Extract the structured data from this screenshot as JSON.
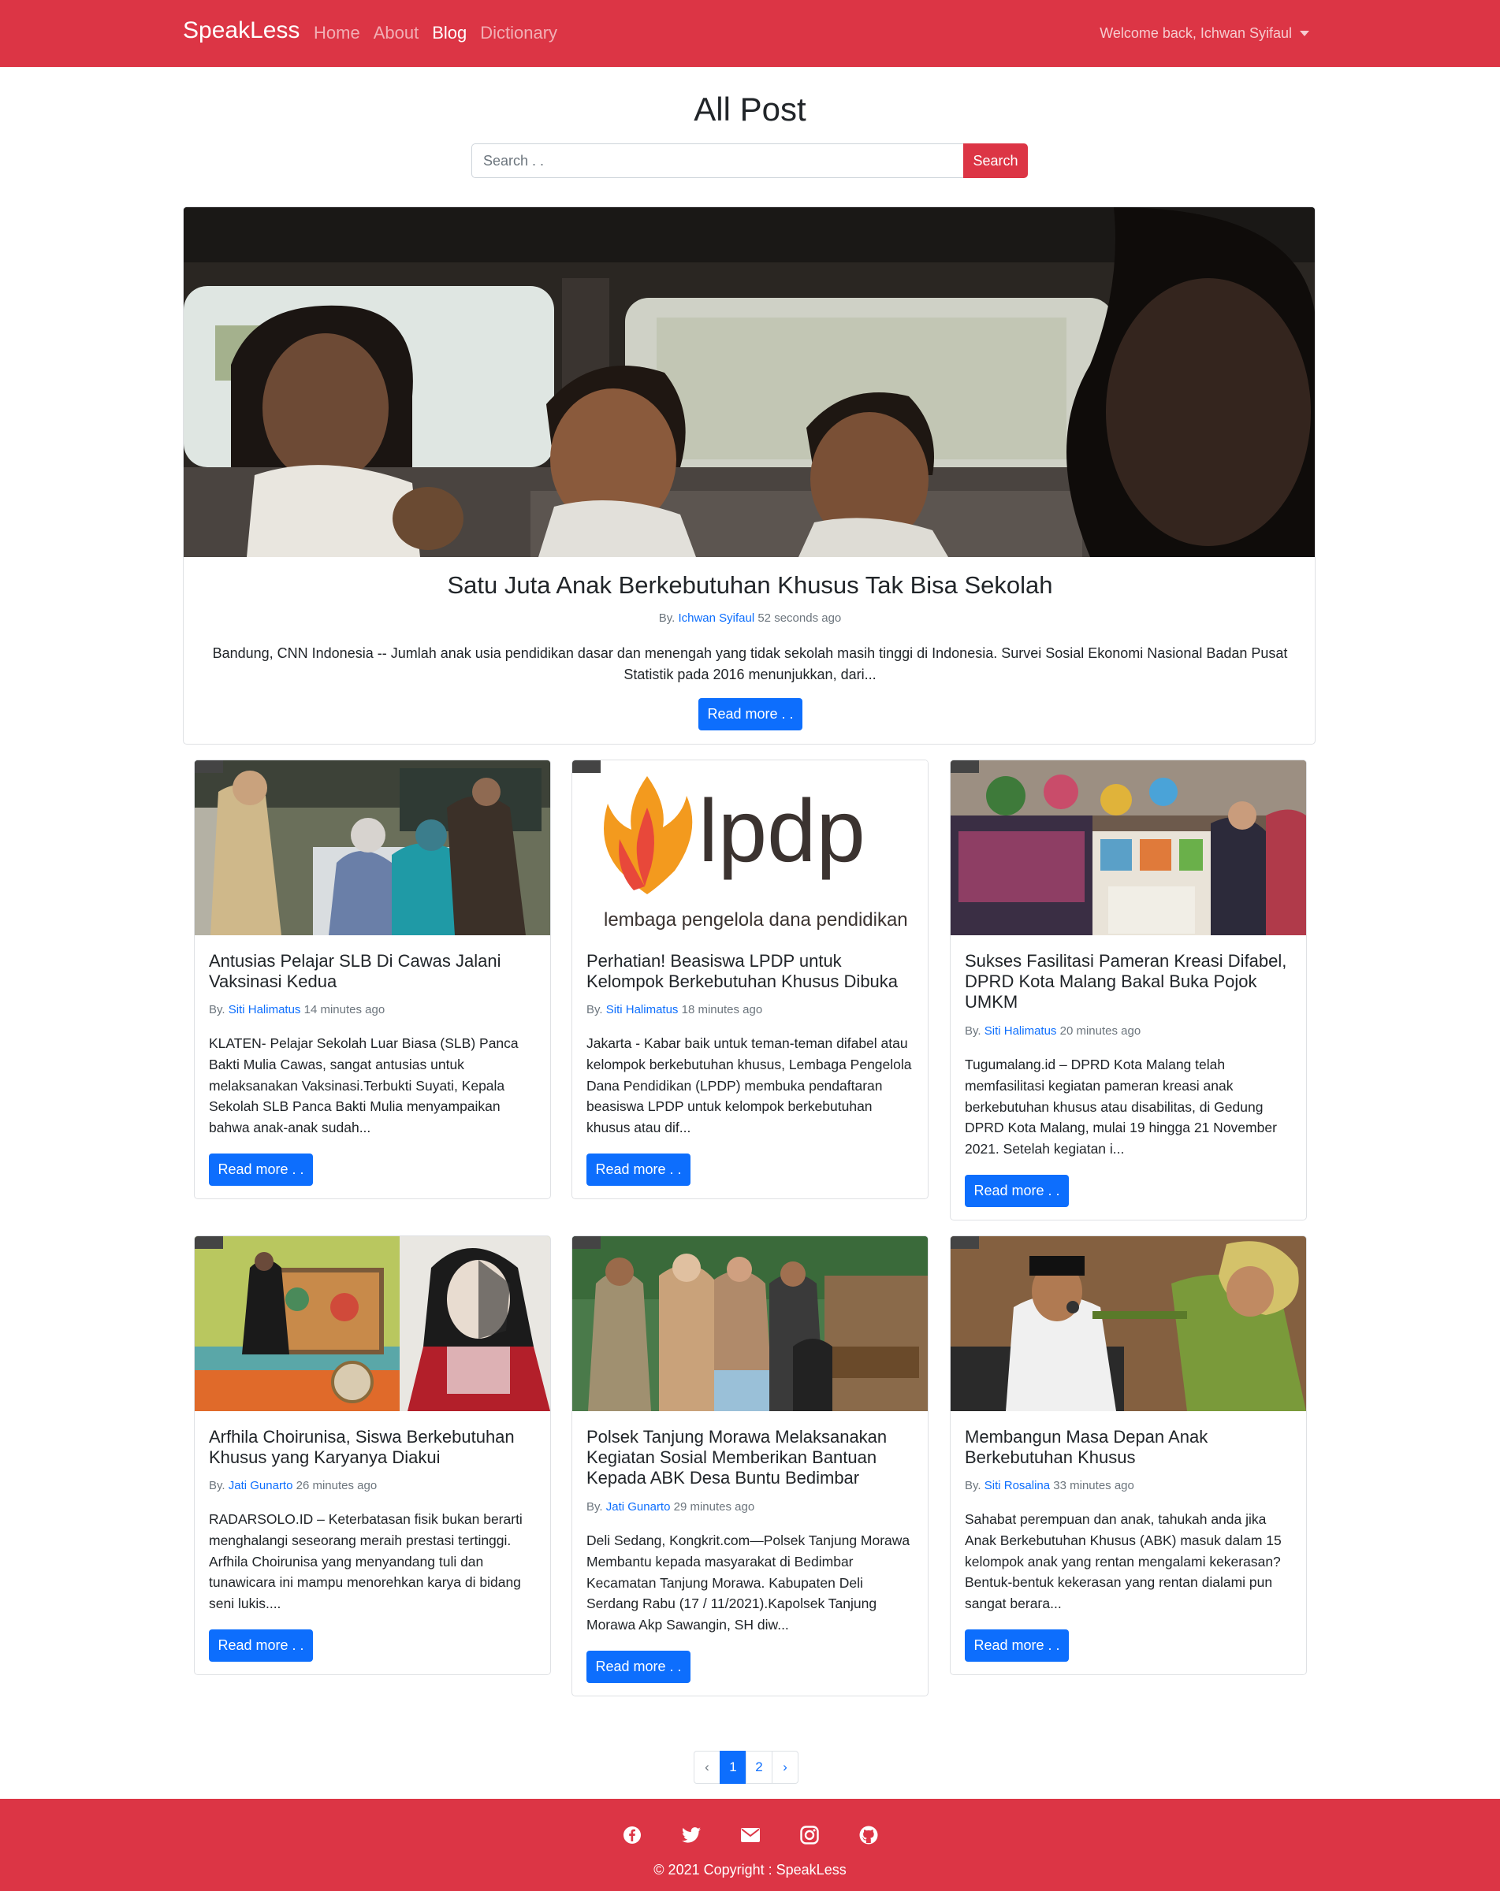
{
  "navbar": {
    "brand": "SpeakLess",
    "links": [
      "Home",
      "About",
      "Blog",
      "Dictionary"
    ],
    "active_link": "Blog",
    "welcome": "Welcome back, Ichwan Syifaul"
  },
  "header": {
    "title": "All Post",
    "search_placeholder": "Search . .",
    "search_button": "Search"
  },
  "featured": {
    "title": "Satu Juta Anak Berkebutuhan Khusus Tak Bisa Sekolah",
    "by": "By.",
    "author": "Ichwan Syifaul",
    "time": "52 seconds ago",
    "excerpt": "Bandung, CNN Indonesia -- Jumlah anak usia pendidikan dasar dan menengah yang tidak sekolah masih tinggi di Indonesia. Survei Sosial Ekonomi Nasional Badan Pusat Statistik pada 2016 menunjukkan, dari...",
    "read_more": "Read more . ."
  },
  "posts": [
    {
      "title": "Antusias Pelajar SLB Di Cawas Jalani Vaksinasi Kedua",
      "by": "By.",
      "author": "Siti Halimatus",
      "time": "14 minutes ago",
      "excerpt": "KLATEN- Pelajar Sekolah Luar Biasa (SLB) Panca Bakti Mulia Cawas, sangat antusias untuk melaksanakan Vaksinasi.Terbukti Suyati, Kepala Sekolah SLB Panca Bakti Mulia menyampaikan bahwa anak-anak sudah...",
      "read_more": "Read more . ."
    },
    {
      "title": "Perhatian! Beasiswa LPDP untuk Kelompok Berkebutuhan Khusus Dibuka",
      "by": "By.",
      "author": "Siti Halimatus",
      "time": "18 minutes ago",
      "excerpt": "Jakarta - Kabar baik untuk teman-teman difabel atau kelompok berkebutuhan khusus, Lembaga Pengelola Dana Pendidikan (LPDP) membuka pendaftaran beasiswa LPDP untuk kelompok berkebutuhan khusus atau dif...",
      "read_more": "Read more . .",
      "logo_text": "lpdp",
      "logo_sub": "lembaga pengelola dana pendidikan"
    },
    {
      "title": "Sukses Fasilitasi Pameran Kreasi Difabel, DPRD Kota Malang Bakal Buka Pojok UMKM",
      "by": "By.",
      "author": "Siti Halimatus",
      "time": "20 minutes ago",
      "excerpt": "Tugumalang.id – DPRD Kota Malang telah memfasilitasi kegiatan pameran kreasi anak berkebutuhan khusus atau disabilitas, di Gedung DPRD Kota Malang, mulai 19 hingga 21 November 2021. Setelah kegiatan i...",
      "read_more": "Read more . ."
    },
    {
      "title": "Arfhila Choirunisa, Siswa Berkebutuhan Khusus yang Karyanya Diakui",
      "by": "By.",
      "author": "Jati Gunarto",
      "time": "26 minutes ago",
      "excerpt": "RADARSOLO.ID – Keterbatasan fisik bukan berarti menghalangi seseorang meraih prestasi tertinggi. Arfhila Choirunisa yang menyandang tuli dan tunawicara ini mampu menorehkan karya di bidang seni lukis....",
      "read_more": "Read more . ."
    },
    {
      "title": "Polsek Tanjung Morawa Melaksanakan Kegiatan Sosial Memberikan Bantuan Kepada ABK Desa Buntu Bedimbar",
      "by": "By.",
      "author": "Jati Gunarto",
      "time": "29 minutes ago",
      "excerpt": "Deli Sedang, Kongkrit.com—Polsek Tanjung Morawa Membantu kepada masyarakat di Bedimbar Kecamatan Tanjung Morawa. Kabupaten Deli Serdang Rabu (17 / 11/2021).Kapolsek Tanjung Morawa Akp Sawangin, SH diw...",
      "read_more": "Read more . ."
    },
    {
      "title": "Membangun Masa Depan Anak Berkebutuhan Khusus",
      "by": "By.",
      "author": "Siti Rosalina",
      "time": "33 minutes ago",
      "excerpt": "Sahabat perempuan dan anak, tahukah anda jika Anak Berkebutuhan Khusus (ABK) masuk dalam 15 kelompok anak yang rentan mengalami kekerasan? Bentuk-bentuk kekerasan yang rentan dialami pun sangat berага...",
      "read_more": "Read more . ."
    }
  ],
  "pagination": {
    "prev": "‹",
    "pages": [
      "1",
      "2"
    ],
    "current": "1",
    "next": "›"
  },
  "footer": {
    "socials": [
      "facebook-icon",
      "twitter-icon",
      "envelope-icon",
      "instagram-icon",
      "github-icon"
    ],
    "copyright": "© 2021 Copyright : SpeakLess"
  },
  "colors": {
    "brand": "#dc3545",
    "primary": "#0d6efd"
  }
}
